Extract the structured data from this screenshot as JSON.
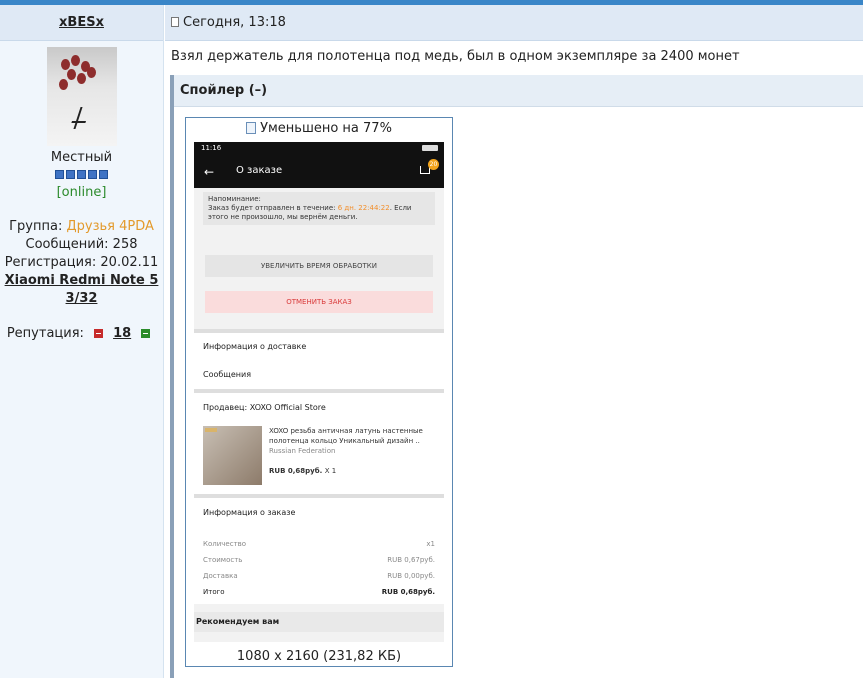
{
  "user": {
    "nick": "xBESx",
    "rank": "Местный",
    "status": "[online]",
    "group_label": "Группа:",
    "group_value": "Друзья 4PDA",
    "posts_label": "Сообщений:",
    "posts_value": "258",
    "reg_label": "Регистрация:",
    "reg_value": "20.02.11",
    "device": "Xiaomi Redmi Note 5 3/32",
    "rep_label": "Репутация:",
    "rep_value": "18"
  },
  "post": {
    "date": "Сегодня, 13:18",
    "text": "Взял держатель для полотенца под медь, был в одном экземпляре за 2400 монет"
  },
  "spoiler": {
    "title": "Спойлер (–)"
  },
  "image": {
    "caption": "Уменьшено на 77%",
    "footer": "1080 x 2160 (231,82 КБ)"
  },
  "phone": {
    "clock": "11:16",
    "cart_badge": "20",
    "title": "О заказе",
    "notice_title": "Напоминание:",
    "notice_pre": "Заказ будет отправлен в течение:",
    "notice_time": "6 дн. 22:44:22",
    "notice_post": ". Если этого не произошло, мы вернём деньги.",
    "btn_extend": "УВЕЛИЧИТЬ ВРЕМЯ ОБРАБОТКИ",
    "btn_cancel": "ОТМЕНИТЬ ЗАКАЗ",
    "delivery_info": "Информация о доставке",
    "messages": "Сообщения",
    "seller": "Продавец: XOXO Official Store",
    "product_name": "XOXO резьба античная латунь настенные полотенца кольцо Уникальный дизайн ..",
    "product_region": "Russian Federation",
    "product_price": "RUB 0,68руб.",
    "product_qty": "X 1",
    "order_info": "Информация о заказе",
    "lines": [
      {
        "label": "Количество",
        "value": "x1"
      },
      {
        "label": "Стоимость",
        "value": "RUB 0,67руб."
      },
      {
        "label": "Доставка",
        "value": "RUB 0,00руб."
      },
      {
        "label": "Итого",
        "value": "RUB 0,68руб."
      }
    ],
    "recommend": "Рекомендуем вам"
  }
}
